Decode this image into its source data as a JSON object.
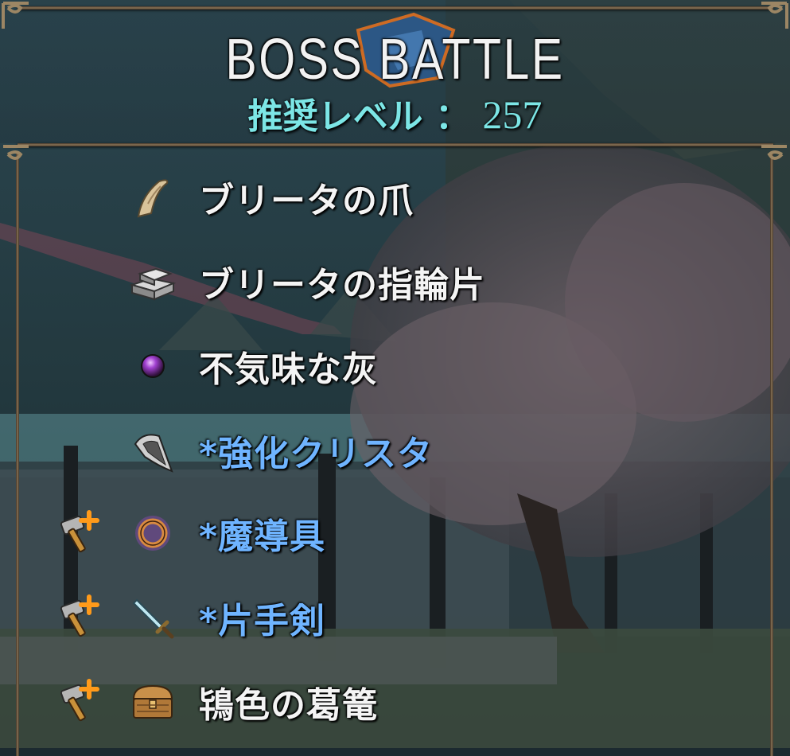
{
  "header": {
    "title": "BOSS BATTLE",
    "level_label": "推奨レベル ：",
    "level_value": "257"
  },
  "drops": [
    {
      "label": "ブリータの爪",
      "icon": "claw-icon",
      "highlight": false,
      "craftable": false
    },
    {
      "label": "ブリータの指輪片",
      "icon": "metal-ingot-icon",
      "highlight": false,
      "craftable": false
    },
    {
      "label": "不気味な灰",
      "icon": "purple-orb-icon",
      "highlight": false,
      "craftable": false
    },
    {
      "label": "*強化クリスタ",
      "icon": "crystal-shard-icon",
      "highlight": true,
      "craftable": false
    },
    {
      "label": "*魔導具",
      "icon": "magic-ring-icon",
      "highlight": true,
      "craftable": true
    },
    {
      "label": "*片手剣",
      "icon": "sword-icon",
      "highlight": true,
      "craftable": true
    },
    {
      "label": "鴇色の葛篭",
      "icon": "treasure-chest-icon",
      "highlight": false,
      "craftable": true
    }
  ],
  "colors": {
    "highlight_text": "#6fb4ff",
    "normal_text": "#f4f4f4",
    "level_text": "#7ce6e6",
    "craft_plus": "#ff9a1a"
  }
}
